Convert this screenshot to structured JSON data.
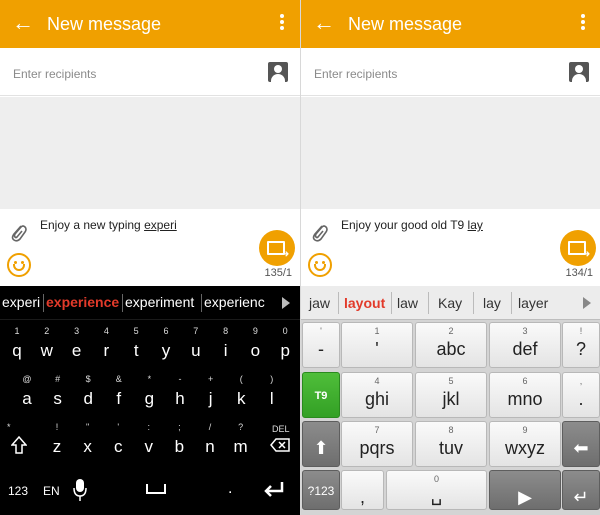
{
  "left": {
    "app_bar": {
      "title": "New message"
    },
    "recipients": {
      "placeholder": "Enter recipients"
    },
    "message": {
      "text_plain": "Enjoy a new typing ",
      "text_underlined": "experi"
    },
    "char_count": "135/1",
    "suggestions": [
      "experi",
      "experience",
      "experiment",
      "experienc"
    ],
    "keyboard": {
      "row1": [
        {
          "hint": "1",
          "label": "q"
        },
        {
          "hint": "2",
          "label": "w"
        },
        {
          "hint": "3",
          "label": "e"
        },
        {
          "hint": "4",
          "label": "r"
        },
        {
          "hint": "5",
          "label": "t"
        },
        {
          "hint": "6",
          "label": "y"
        },
        {
          "hint": "7",
          "label": "u"
        },
        {
          "hint": "8",
          "label": "i"
        },
        {
          "hint": "9",
          "label": "o"
        },
        {
          "hint": "0",
          "label": "p"
        }
      ],
      "row2": [
        {
          "hint": "@",
          "label": "a"
        },
        {
          "hint": "#",
          "label": "s"
        },
        {
          "hint": "$",
          "label": "d"
        },
        {
          "hint": "&",
          "label": "f"
        },
        {
          "hint": "*",
          "label": "g"
        },
        {
          "hint": "-",
          "label": "h"
        },
        {
          "hint": "+",
          "label": "j"
        },
        {
          "hint": "(",
          "label": "k"
        },
        {
          "hint": ")",
          "label": "l"
        }
      ],
      "row3": [
        {
          "hint": "!",
          "label": "z"
        },
        {
          "hint": "\"",
          "label": "x"
        },
        {
          "hint": "'",
          "label": "c"
        },
        {
          "hint": ":",
          "label": "v"
        },
        {
          "hint": ";",
          "label": "b"
        },
        {
          "hint": "/",
          "label": "n"
        },
        {
          "hint": "?",
          "label": "m"
        }
      ],
      "shift_hint": "*",
      "delete_label": "DEL",
      "numbers_label": "123",
      "language_label": "EN",
      "period_key": "."
    }
  },
  "right": {
    "app_bar": {
      "title": "New message"
    },
    "recipients": {
      "placeholder": "Enter recipients"
    },
    "message": {
      "text_plain": "Enjoy your good old T9 ",
      "text_underlined": "lay"
    },
    "char_count": "134/1",
    "suggestions": [
      "jaw",
      "layout",
      "law",
      "Kay",
      "lay",
      "layer"
    ],
    "keyboard": {
      "row1": [
        {
          "hint": "'",
          "label": "-"
        },
        {
          "hint": "1",
          "label": "'"
        },
        {
          "hint": "2",
          "label": "abc"
        },
        {
          "hint": "3",
          "label": "def"
        },
        {
          "hint": "!",
          "label": "?"
        }
      ],
      "row2": [
        {
          "hint": "",
          "label": "T9"
        },
        {
          "hint": "4",
          "label": "ghi"
        },
        {
          "hint": "5",
          "label": "jkl"
        },
        {
          "hint": "6",
          "label": "mno"
        },
        {
          "hint": ",",
          "label": "."
        }
      ],
      "row3": [
        {
          "hint": "",
          "label": "⬆"
        },
        {
          "hint": "7",
          "label": "pqrs"
        },
        {
          "hint": "8",
          "label": "tuv"
        },
        {
          "hint": "9",
          "label": "wxyz"
        },
        {
          "hint": "",
          "label": "⬅"
        }
      ],
      "row4": [
        {
          "hint": "",
          "label": "?123"
        },
        {
          "hint": "",
          "label": ","
        },
        {
          "hint": "0",
          "label": "␣"
        },
        {
          "hint": "",
          "label": "▶"
        },
        {
          "hint": "",
          "label": "↵"
        }
      ]
    }
  },
  "colors": {
    "accent": "#f0a000",
    "highlight": "#e23a2a",
    "t9_green": "#3aa82b"
  }
}
